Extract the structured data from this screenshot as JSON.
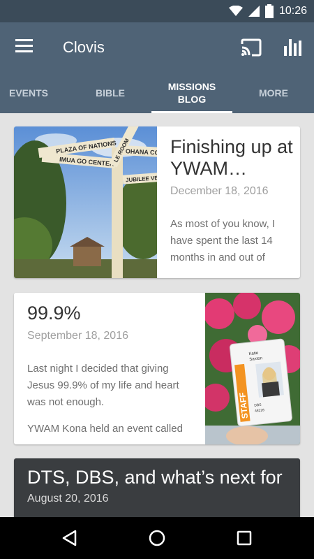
{
  "status_bar": {
    "time": "10:26"
  },
  "app_bar": {
    "title": "Clovis"
  },
  "tabs": [
    {
      "label": "EVENTS"
    },
    {
      "label": "BIBLE"
    },
    {
      "label": "MISSIONS\nBLOG",
      "active": true
    },
    {
      "label": "MORE"
    }
  ],
  "posts": [
    {
      "title": "Finishing up at YWAM…",
      "date": "December 18, 2016",
      "excerpt": "As most of you know, I have spent the last 14 months in and out of"
    },
    {
      "title": "99.9%",
      "date": "September 18, 2016",
      "excerpt": "Last night I decided that giving Jesus 99.9% of my life and heart was not enough.",
      "excerpt_more": "YWAM Kona held an event called"
    },
    {
      "title": "DTS, DBS, and what’s next for",
      "date": "August 20, 2016"
    }
  ],
  "signpost": [
    "PLAZA OF NATIONS",
    "IMUA GO CENTER",
    "OHANA COU",
    "JUBILEE VENU",
    "LE ROOM"
  ],
  "badge": {
    "staff": "STAFF",
    "first": "Katie",
    "last": "Saxton",
    "code1": "DBS",
    "code2": "48226"
  },
  "colors": {
    "app_bar": "#4f6376",
    "status_bar": "#3b4b59",
    "accent": "#ffffff"
  }
}
